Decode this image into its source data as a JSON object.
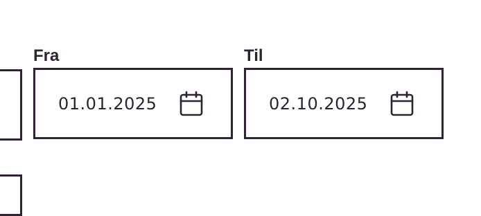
{
  "date_range": {
    "from": {
      "label": "Fra",
      "value": "01.01.2025",
      "icon": "calendar-icon"
    },
    "to": {
      "label": "Til",
      "value": "02.10.2025",
      "icon": "calendar-icon"
    }
  },
  "colors": {
    "border": "#2f2233",
    "text": "#2f2233",
    "background": "#ffffff"
  }
}
